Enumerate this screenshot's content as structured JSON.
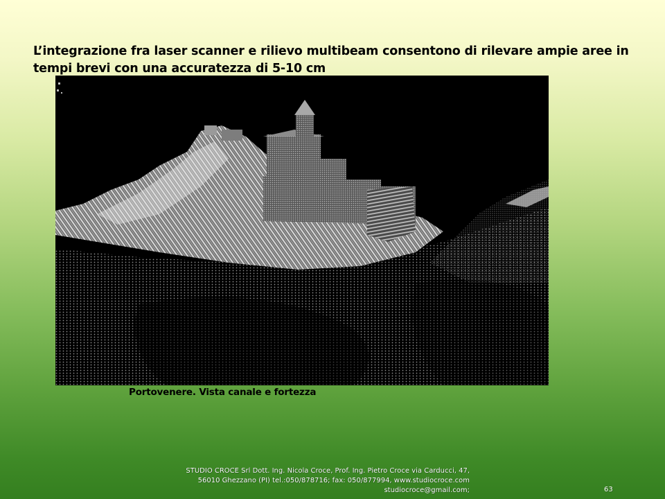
{
  "slide": {
    "title": "L’integrazione fra laser scanner e rilievo multibeam consentono di rilevare ampie aree in tempi brevi con una accuratezza di 5-10 cm",
    "caption": "Portovenere. Vista canale e fortezza",
    "footer": {
      "line1": "STUDIO CROCE Srl   Dott. Ing. Nicola Croce, Prof. Ing. Pietro Croce  via Carducci, 47,",
      "line2": "56010 Ghezzano (PI) tel.:050/878716; fax: 050/877994, www.studiocroce.com",
      "line3": "studiocroce@gmail.com;"
    },
    "page_number": "63"
  },
  "colors": {
    "gradient_top": "#ffffd6",
    "gradient_bottom": "#347f1f",
    "image_background": "#000000"
  }
}
